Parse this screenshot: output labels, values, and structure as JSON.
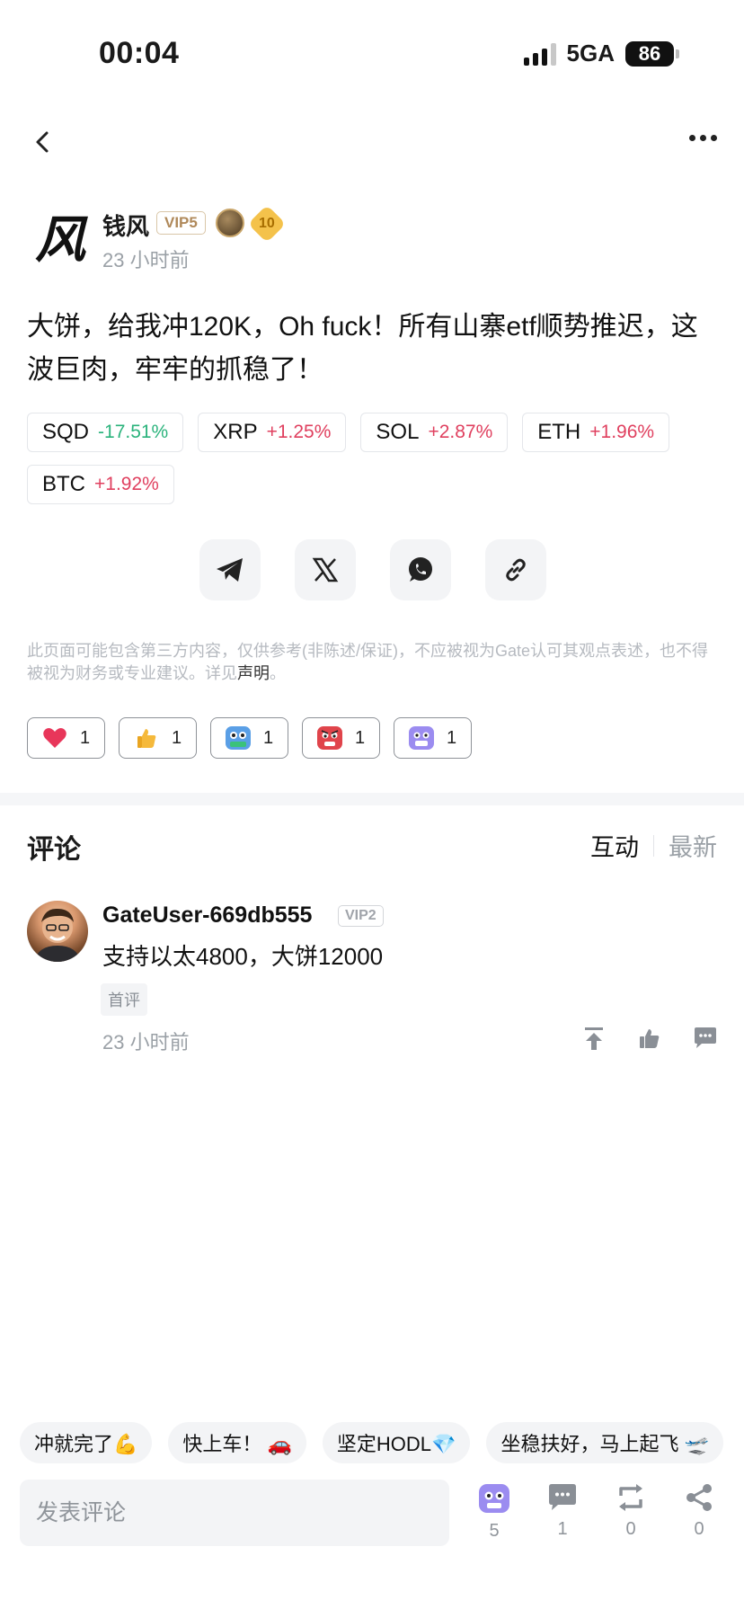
{
  "status_bar": {
    "time": "00:04",
    "network": "5GA",
    "battery": "86"
  },
  "author": {
    "avatar_text": "风",
    "name": "钱风",
    "vip": "VIP5",
    "badge_level": "10",
    "time": "23 小时前"
  },
  "post": {
    "text": "大饼，给我冲120K，Oh fuck！所有山寨etf顺势推迟，这波巨肉，牢牢的抓稳了！",
    "tickers": [
      {
        "symbol": "SQD",
        "change": "-17.51%",
        "direction": "down"
      },
      {
        "symbol": "XRP",
        "change": "+1.25%",
        "direction": "up"
      },
      {
        "symbol": "SOL",
        "change": "+2.87%",
        "direction": "up"
      },
      {
        "symbol": "ETH",
        "change": "+1.96%",
        "direction": "up"
      },
      {
        "symbol": "BTC",
        "change": "+1.92%",
        "direction": "up"
      }
    ],
    "share_icons": [
      "telegram-icon",
      "x-icon",
      "whatsapp-icon",
      "link-icon"
    ]
  },
  "disclaimer": {
    "text": "此页面可能包含第三方内容，仅供参考(非陈述/保证)，不应被视为Gate认可其观点表述，也不得被视为财务或专业建议。详见",
    "link": "声明",
    "end": "。"
  },
  "reactions": [
    {
      "icon": "heart-icon",
      "count": "1"
    },
    {
      "icon": "thumbs-up-icon",
      "count": "1"
    },
    {
      "icon": "robot-face-icon",
      "count": "1"
    },
    {
      "icon": "angry-face-icon",
      "count": "1"
    },
    {
      "icon": "purple-face-icon",
      "count": "1"
    }
  ],
  "comments": {
    "title": "评论",
    "sort": {
      "active": "互动",
      "inactive": "最新"
    },
    "items": [
      {
        "user": "GateUser-669db555",
        "vip": "VIP2",
        "text": "支持以太4800，大饼12000",
        "tag": "首评",
        "time": "23 小时前"
      }
    ]
  },
  "quick_replies": [
    "冲就完了💪",
    "快上车！ 🚗",
    "坚定HODL💎",
    "坐稳扶好，马上起飞 🛫"
  ],
  "bottom_bar": {
    "input_placeholder": "发表评论",
    "actions": [
      {
        "icon": "reaction-face-icon",
        "count": "5"
      },
      {
        "icon": "comment-icon",
        "count": "1"
      },
      {
        "icon": "repost-icon",
        "count": "0"
      },
      {
        "icon": "share-icon",
        "count": "0"
      }
    ]
  },
  "colors": {
    "up": "#e0405f",
    "down": "#2bb37c",
    "vip_gold": "#b0895a"
  }
}
